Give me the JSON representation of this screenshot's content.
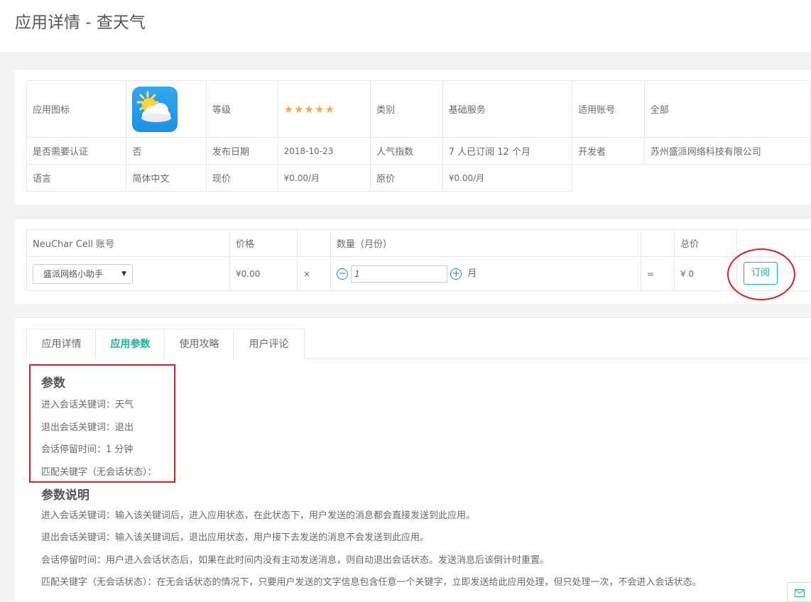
{
  "header": {
    "title": "应用详情 - 查天气"
  },
  "info": {
    "icon_label": "应用图标",
    "level_label": "等级",
    "stars": "★★★★★",
    "category_label": "类别",
    "category_value": "基础服务",
    "account_label": "适用账号",
    "account_value": "全部",
    "auth_label": "是否需要认证",
    "auth_value": "否",
    "date_label": "发布日期",
    "date_value": "2018-10-23",
    "popularity_label": "人气指数",
    "popularity_value": "7 人已订阅 12 个月",
    "developer_label": "开发者",
    "developer_value": "苏州盛派网络科技有限公司",
    "lang_label": "语言",
    "lang_value": "简体中文",
    "price_label": "现价",
    "price_value": "¥0.00/月",
    "orig_label": "原价",
    "orig_value": "¥0.00/月"
  },
  "order": {
    "account_header": "NeuChar Cell 账号",
    "price_header": "价格",
    "qty_header": "数量（月份）",
    "total_header": "总价",
    "account_select": "盛派网络小助手",
    "price": "¥0.00",
    "times": "×",
    "minus": "−",
    "qty": "1",
    "plus": "+",
    "unit": "月",
    "equals": "=",
    "total": "¥ 0",
    "subscribe": "订阅"
  },
  "tabs": [
    "应用详情",
    "应用参数",
    "使用攻略",
    "用户评论"
  ],
  "params": {
    "title": "参数",
    "items": [
      "进入会话关键词：天气",
      "退出会话关键词：退出",
      "会话停留时间：1 分钟",
      "匹配关键字（无会话状态）："
    ]
  },
  "desc": {
    "title": "参数说明",
    "items": [
      "进入会话关键词：输入该关键词后，进入应用状态，在此状态下，用户发送的消息都会直接发送到此应用。",
      "退出会话关键词：输入该关键词后，退出应用状态，用户接下去发送的消息不会发送到此应用。",
      "会话停留时间：用户进入会话状态后，如果在此时间内没有主动发送消息，则自动退出会话状态。发送消息后该倒计时重置。",
      "匹配关键字（无会话状态）：在无会话状态的情况下，只要用户发送的文字信息包含任意一个关键字，立即发送给此应用处理，但只处理一次，不会进入会话状态。"
    ]
  },
  "colors": {
    "accent": "#1ab394",
    "highlight": "#e31b1b",
    "star": "#f0ad4e"
  },
  "icons": {
    "app": "weather-app-icon",
    "mail": "mail-icon"
  }
}
